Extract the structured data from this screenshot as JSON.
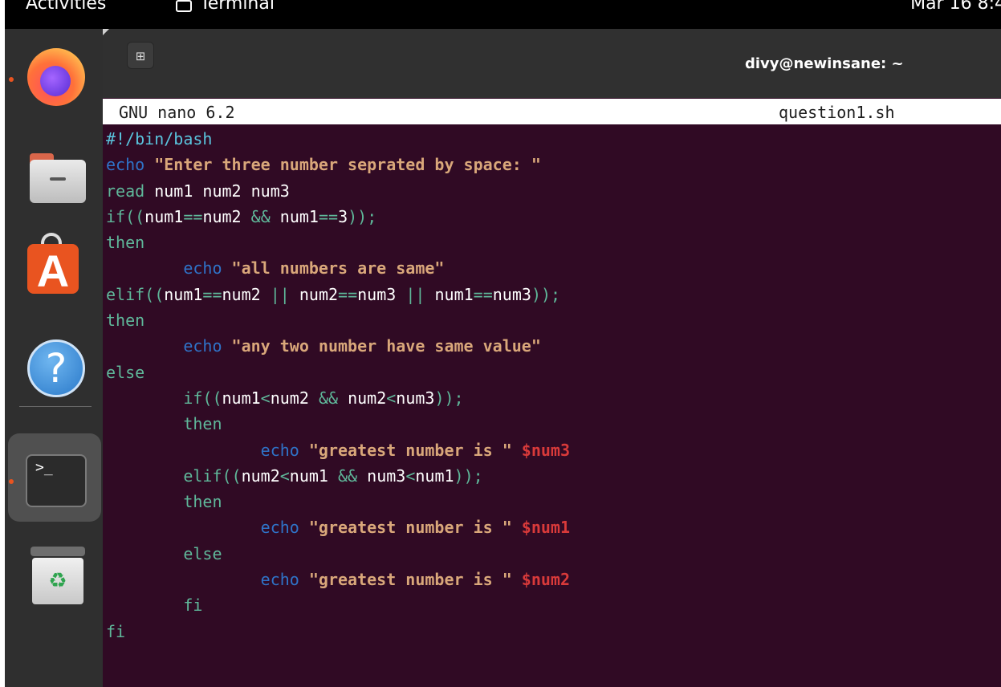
{
  "topbar": {
    "activities": "Activities",
    "app_name": "Terminal",
    "clock": "Mar 16  8:4"
  },
  "dock": {
    "items": [
      {
        "name": "firefox",
        "icon": "firefox-icon",
        "running": true
      },
      {
        "name": "files",
        "icon": "folder-icon",
        "running": false
      },
      {
        "name": "app-center",
        "icon": "store-icon",
        "running": false
      },
      {
        "name": "help",
        "icon": "help-icon",
        "glyph": "?",
        "running": false
      },
      {
        "name": "terminal",
        "icon": "terminal-icon",
        "glyph": ">_",
        "running": true,
        "active": true
      },
      {
        "name": "trash",
        "icon": "trash-icon",
        "glyph": "♻",
        "running": false
      }
    ]
  },
  "window": {
    "new_tab_glyph": "⊞",
    "title": "divy@newinsane: ~"
  },
  "nano": {
    "version": "GNU nano 6.2",
    "filename": "question1.sh"
  },
  "colors": {
    "terminal_bg": "#300a24",
    "dock_bg": "#2f2f2f",
    "headerbar_bg": "#303030",
    "accent": "#e95420",
    "comment": "#5ac5de",
    "keyword": "#5fb89a",
    "builtin": "#2f73c8",
    "string": "#d9a77a",
    "variable": "#d93a3a"
  },
  "code_lines": [
    [
      [
        "comment",
        "#!/bin/bash"
      ]
    ],
    [
      [
        "builtin",
        "echo"
      ],
      [
        "plain",
        " "
      ],
      [
        "string",
        "\"Enter three number seprated by space: \""
      ]
    ],
    [
      [
        "kw",
        "read"
      ],
      [
        "plain",
        " num1 num2 num3"
      ]
    ],
    [
      [
        "kw",
        "if(("
      ],
      [
        "plain",
        "num1"
      ],
      [
        "kw",
        "=="
      ],
      [
        "plain",
        "num2 "
      ],
      [
        "kw",
        "&&"
      ],
      [
        "plain",
        " num1"
      ],
      [
        "kw",
        "=="
      ],
      [
        "plain",
        "3"
      ],
      [
        "kw",
        "));"
      ]
    ],
    [
      [
        "kw",
        "then"
      ]
    ],
    [
      [
        "plain",
        "        "
      ],
      [
        "builtin",
        "echo"
      ],
      [
        "plain",
        " "
      ],
      [
        "string",
        "\"all numbers are same\""
      ]
    ],
    [
      [
        "kw",
        "elif(("
      ],
      [
        "plain",
        "num1"
      ],
      [
        "kw",
        "=="
      ],
      [
        "plain",
        "num2 "
      ],
      [
        "kw",
        "||"
      ],
      [
        "plain",
        " num2"
      ],
      [
        "kw",
        "=="
      ],
      [
        "plain",
        "num3 "
      ],
      [
        "kw",
        "||"
      ],
      [
        "plain",
        " num1"
      ],
      [
        "kw",
        "=="
      ],
      [
        "plain",
        "num3"
      ],
      [
        "kw",
        "));"
      ]
    ],
    [
      [
        "kw",
        "then"
      ]
    ],
    [
      [
        "plain",
        "        "
      ],
      [
        "builtin",
        "echo"
      ],
      [
        "plain",
        " "
      ],
      [
        "string",
        "\"any two number have same value\""
      ]
    ],
    [
      [
        "kw",
        "else"
      ]
    ],
    [
      [
        "plain",
        "        "
      ],
      [
        "kw",
        "if(("
      ],
      [
        "plain",
        "num1"
      ],
      [
        "kw",
        "<"
      ],
      [
        "plain",
        "num2 "
      ],
      [
        "kw",
        "&&"
      ],
      [
        "plain",
        " num2"
      ],
      [
        "kw",
        "<"
      ],
      [
        "plain",
        "num3"
      ],
      [
        "kw",
        "));"
      ]
    ],
    [
      [
        "plain",
        "        "
      ],
      [
        "kw",
        "then"
      ]
    ],
    [
      [
        "plain",
        "                "
      ],
      [
        "builtin",
        "echo"
      ],
      [
        "plain",
        " "
      ],
      [
        "string",
        "\"greatest number is \""
      ],
      [
        "plain",
        " "
      ],
      [
        "var",
        "$num3"
      ]
    ],
    [
      [
        "plain",
        "        "
      ],
      [
        "kw",
        "elif(("
      ],
      [
        "plain",
        "num2"
      ],
      [
        "kw",
        "<"
      ],
      [
        "plain",
        "num1 "
      ],
      [
        "kw",
        "&&"
      ],
      [
        "plain",
        " num3"
      ],
      [
        "kw",
        "<"
      ],
      [
        "plain",
        "num1"
      ],
      [
        "kw",
        "));"
      ]
    ],
    [
      [
        "plain",
        "        "
      ],
      [
        "kw",
        "then"
      ]
    ],
    [
      [
        "plain",
        "                "
      ],
      [
        "builtin",
        "echo"
      ],
      [
        "plain",
        " "
      ],
      [
        "string",
        "\"greatest number is \""
      ],
      [
        "plain",
        " "
      ],
      [
        "var",
        "$num1"
      ]
    ],
    [
      [
        "plain",
        "        "
      ],
      [
        "kw",
        "else"
      ]
    ],
    [
      [
        "plain",
        "                "
      ],
      [
        "builtin",
        "echo"
      ],
      [
        "plain",
        " "
      ],
      [
        "string",
        "\"greatest number is \""
      ],
      [
        "plain",
        " "
      ],
      [
        "var",
        "$num2"
      ]
    ],
    [
      [
        "plain",
        "        "
      ],
      [
        "kw",
        "fi"
      ]
    ],
    [
      [
        "kw",
        "fi"
      ]
    ]
  ]
}
